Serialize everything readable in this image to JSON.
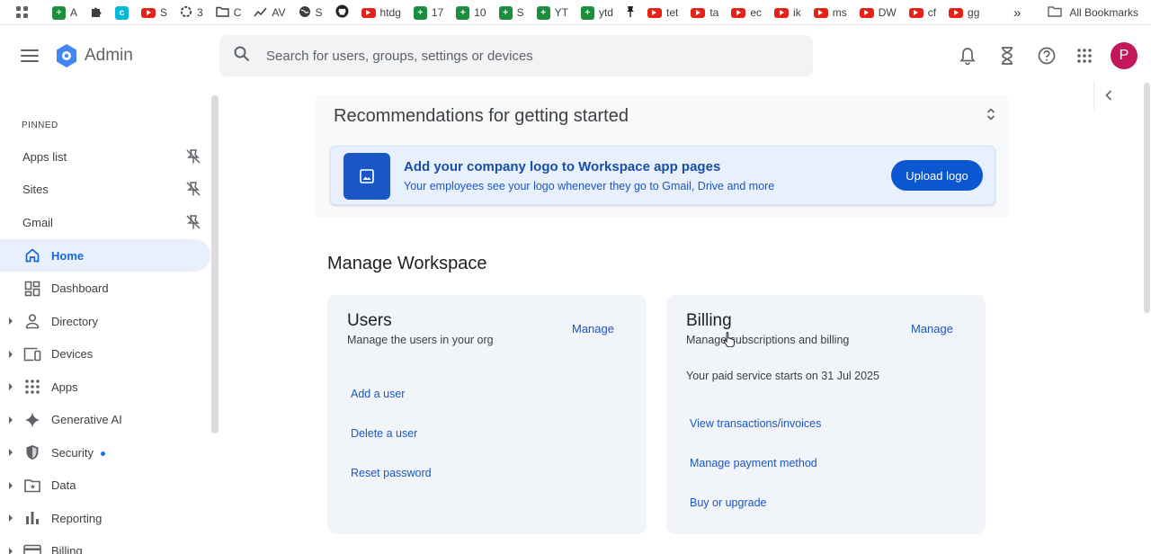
{
  "bookmarks": {
    "items": [
      {
        "label": "A",
        "icon": "sheets-icon"
      },
      {
        "label": "",
        "icon": "puzzle-icon"
      },
      {
        "label": "",
        "icon": "teal-app-icon"
      },
      {
        "label": "S",
        "icon": "youtube-icon"
      },
      {
        "label": "3",
        "icon": "openai-icon"
      },
      {
        "label": "C",
        "icon": "folder-icon"
      },
      {
        "label": "AV",
        "icon": "trend-icon"
      },
      {
        "label": "S",
        "icon": "globe-icon"
      },
      {
        "label": "",
        "icon": "github-icon"
      },
      {
        "label": "htdg",
        "icon": "youtube-icon"
      },
      {
        "label": "17",
        "icon": "sheets-icon"
      },
      {
        "label": "10",
        "icon": "sheets-icon"
      },
      {
        "label": "S",
        "icon": "sheets-icon"
      },
      {
        "label": "YT",
        "icon": "sheets-icon"
      },
      {
        "label": "ytd",
        "icon": "sheets-icon"
      },
      {
        "label": "",
        "icon": "pin-icon"
      },
      {
        "label": "tet",
        "icon": "youtube-icon"
      },
      {
        "label": "ta",
        "icon": "youtube-icon"
      },
      {
        "label": "ec",
        "icon": "youtube-icon"
      },
      {
        "label": "ik",
        "icon": "youtube-icon"
      },
      {
        "label": "ms",
        "icon": "youtube-icon"
      },
      {
        "label": "DW",
        "icon": "youtube-icon"
      },
      {
        "label": "cf",
        "icon": "youtube-icon"
      },
      {
        "label": "gg",
        "icon": "youtube-icon"
      }
    ],
    "overflow": "»",
    "all_bookmarks": "All Bookmarks"
  },
  "header": {
    "app_name": "Admin",
    "search_placeholder": "Search for users, groups, settings or devices",
    "avatar_initial": "P"
  },
  "sidebar": {
    "pinned_label": "PINNED",
    "pinned": [
      {
        "label": "Apps list"
      },
      {
        "label": "Sites"
      },
      {
        "label": "Gmail"
      }
    ],
    "nav": [
      {
        "label": "Home",
        "icon": "home-icon",
        "active": true
      },
      {
        "label": "Dashboard",
        "icon": "dashboard-icon"
      },
      {
        "label": "Directory",
        "icon": "person-icon"
      },
      {
        "label": "Devices",
        "icon": "devices-icon"
      },
      {
        "label": "Apps",
        "icon": "apps-grid-icon"
      },
      {
        "label": "Generative AI",
        "icon": "sparkle-icon"
      },
      {
        "label": "Security",
        "icon": "shield-icon"
      },
      {
        "label": "Data",
        "icon": "folder-data-icon"
      },
      {
        "label": "Reporting",
        "icon": "bar-chart-icon"
      },
      {
        "label": "Billing",
        "icon": "card-icon"
      }
    ]
  },
  "recommendations": {
    "title": "Recommendations for getting started",
    "card_title": "Add your company logo to Workspace app pages",
    "card_subtitle": "Your employees see your logo whenever they go to Gmail, Drive and more",
    "button_label": "Upload logo"
  },
  "manage": {
    "section_title": "Manage Workspace",
    "users": {
      "title": "Users",
      "subtitle": "Manage the users in your org",
      "manage_label": "Manage",
      "links": [
        "Add a user",
        "Delete a user",
        "Reset password"
      ]
    },
    "billing": {
      "title": "Billing",
      "subtitle": "Manage subscriptions and billing",
      "manage_label": "Manage",
      "note": "Your paid service starts on 31 Jul 2025",
      "links": [
        "View transactions/invoices",
        "Manage payment method",
        "Buy or upgrade"
      ]
    }
  },
  "colors": {
    "accent": "#1a73e8",
    "link": "#1a56c4",
    "active_bg": "#e8f0fe",
    "avatar": "#c2185b",
    "primary_button": "#0b57d0"
  }
}
